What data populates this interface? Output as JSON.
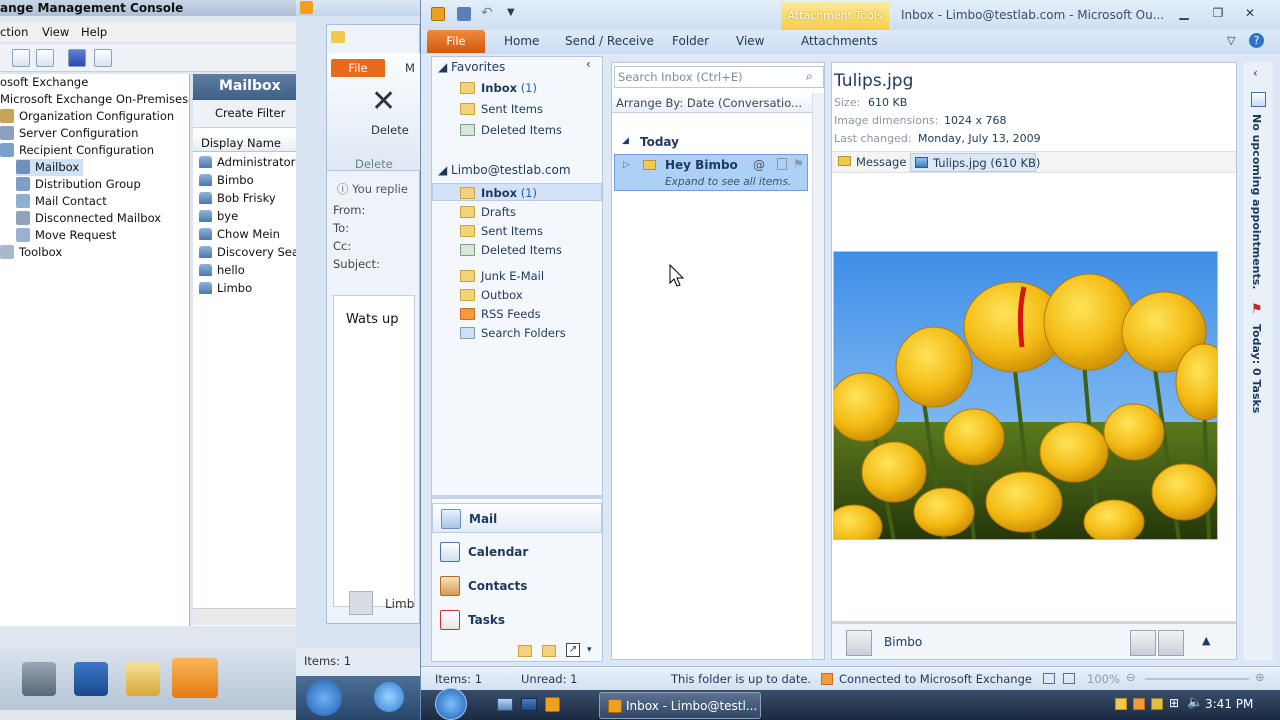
{
  "emc": {
    "title": "ange Management Console",
    "menu": [
      "ction",
      "View",
      "Help"
    ],
    "tree": [
      {
        "label": "osoft Exchange",
        "indent": 0
      },
      {
        "label": "Microsoft Exchange On-Premises (ex",
        "indent": 0
      },
      {
        "label": "Organization Configuration",
        "indent": 1
      },
      {
        "label": "Server Configuration",
        "indent": 1
      },
      {
        "label": "Recipient Configuration",
        "indent": 1
      },
      {
        "label": "Mailbox",
        "indent": 2
      },
      {
        "label": "Distribution Group",
        "indent": 2
      },
      {
        "label": "Mail Contact",
        "indent": 2
      },
      {
        "label": "Disconnected Mailbox",
        "indent": 2
      },
      {
        "label": "Move Request",
        "indent": 2
      },
      {
        "label": "Toolbox",
        "indent": 1
      }
    ],
    "list_title": "Mailbox",
    "create_filter": "Create Filter",
    "column": "Display Name",
    "mailboxes": [
      "Administrator",
      "Bimbo",
      "Bob Frisky",
      "bye",
      "Chow Mein",
      "Discovery Sea",
      "hello",
      "Limbo"
    ]
  },
  "compose": {
    "file_tab": "File",
    "tab2": "M",
    "delete": "Delete",
    "delete_group": "Delete",
    "info": "You replie",
    "from": "From:",
    "to": "To:",
    "cc": "Cc:",
    "subject": "Subject:",
    "body": "Wats up",
    "sender": "Limb",
    "status": "Items: 1"
  },
  "outlook": {
    "title": "Inbox - Limbo@testlab.com  -  Microsoft Ou...",
    "context_tools": "Attachment Tools",
    "tabs": [
      "File",
      "Home",
      "Send / Receive",
      "Folder",
      "View",
      "Attachments"
    ],
    "favorites_header": "Favorites",
    "favorites": [
      {
        "label": "Inbox",
        "count": "(1)"
      },
      {
        "label": "Sent Items",
        "count": ""
      },
      {
        "label": "Deleted Items",
        "count": ""
      }
    ],
    "account_header": "Limbo@testlab.com",
    "folders": [
      {
        "label": "Inbox",
        "count": "(1)"
      },
      {
        "label": "Drafts",
        "count": ""
      },
      {
        "label": "Sent Items",
        "count": ""
      },
      {
        "label": "Deleted Items",
        "count": ""
      },
      {
        "label": "Junk E-Mail",
        "count": ""
      },
      {
        "label": "Outbox",
        "count": ""
      },
      {
        "label": "RSS Feeds",
        "count": ""
      },
      {
        "label": "Search Folders",
        "count": ""
      }
    ],
    "big_nav": [
      "Mail",
      "Calendar",
      "Contacts",
      "Tasks"
    ],
    "search_placeholder": "Search Inbox (Ctrl+E)",
    "arrange_by": "Arrange By: Date (Conversatio...",
    "group_today": "Today",
    "message": {
      "subject": "Hey Bimbo",
      "preview": "Expand to see all items."
    },
    "attachment": {
      "name": "Tulips.jpg",
      "size_label": "Size:",
      "size": "610 KB",
      "dims_label": "Image dimensions:",
      "dims": "1024 x 768",
      "changed_label": "Last changed:",
      "changed": "Monday, July 13, 2009",
      "message_tab": "Message",
      "file_tab": "Tulips.jpg (610 KB)"
    },
    "people_name": "Bimbo",
    "todo_appointments": "No upcoming appointments.",
    "todo_tasks": "Today: 0 Tasks",
    "status": {
      "items": "Items: 1",
      "unread": "Unread: 1",
      "uptodate": "This folder is up to date.",
      "connected": "Connected to Microsoft Exchange",
      "zoom": "100%"
    },
    "taskbar_task": "Inbox - Limbo@testl...",
    "clock": "3:41 PM"
  }
}
